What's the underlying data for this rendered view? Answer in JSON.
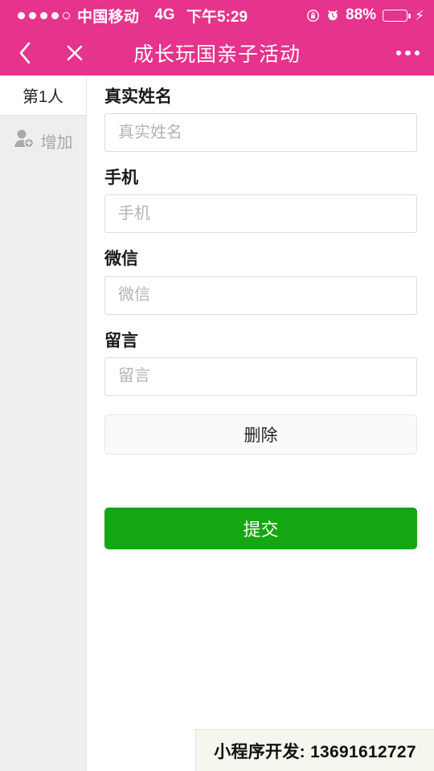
{
  "status_bar": {
    "signal_dots_filled": 4,
    "signal_dots_total": 5,
    "carrier": "中国移动",
    "network": "4G",
    "time": "下午5:29",
    "battery_percent": "88%",
    "battery_level": 88,
    "icons": [
      "rotation-lock-icon",
      "alarm-clock-icon",
      "battery-icon",
      "charging-bolt-icon"
    ],
    "bolt": "⚡",
    "background_color": "#e6338c"
  },
  "nav_bar": {
    "back_label": "‹",
    "close_label": "✕",
    "title": "成长玩国亲子活动",
    "more_label": "•••",
    "background_color": "#e6338c",
    "text_color": "#ffffff"
  },
  "sidebar": {
    "person_tab": {
      "label": "第1人",
      "active": true
    },
    "add_row": {
      "label": "增加",
      "icon": "add-person-icon"
    },
    "background_color": "#eeeeee"
  },
  "form": {
    "fields": [
      {
        "label": "真实姓名",
        "placeholder": "真实姓名",
        "value": ""
      },
      {
        "label": "手机",
        "placeholder": "手机",
        "value": ""
      },
      {
        "label": "微信",
        "placeholder": "微信",
        "value": ""
      },
      {
        "label": "留言",
        "placeholder": "留言",
        "value": ""
      }
    ],
    "delete_label": "删除",
    "submit_label": "提交",
    "submit_color": "#14a711"
  },
  "watermark": {
    "text": "小程序开发: 13691612727",
    "background_color": "#f3f7ee"
  }
}
